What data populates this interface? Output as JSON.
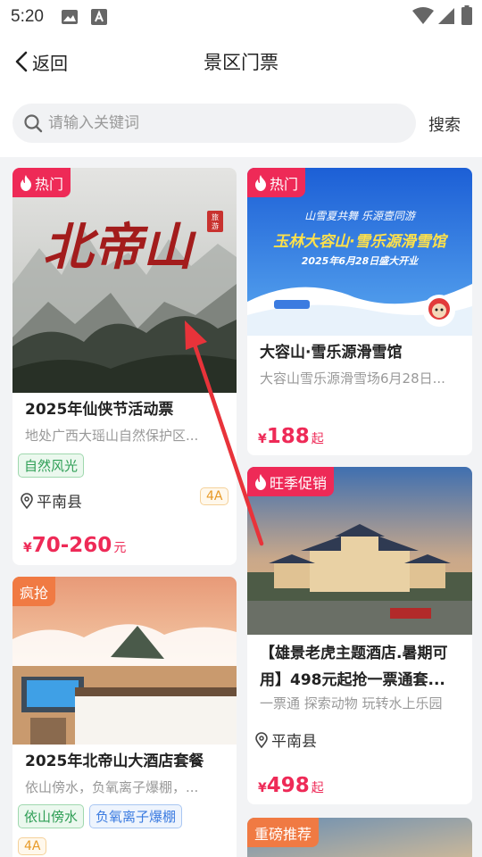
{
  "status_bar": {
    "time": "5:20"
  },
  "nav": {
    "back_label": "返回",
    "title": "景区门票"
  },
  "search": {
    "placeholder": "请输入关键词",
    "value": "",
    "button_label": "搜索"
  },
  "colors": {
    "accent": "#ee2a57",
    "badge_orange": "#f07a43",
    "tag_green": "#2e9e55",
    "tag_blue": "#3b7be0",
    "level_orange": "#e79a27"
  },
  "cards": [
    {
      "badge": "热门",
      "image_logo_text": "北帝山",
      "image_seal_text": "旅游",
      "title": "2025年仙侠节活动票",
      "subtitle": "地处广西大瑶山自然保护区...",
      "tags": [
        "自然风光"
      ],
      "level": "4A",
      "location": "平南县",
      "price_currency": "¥",
      "price": "70-260",
      "price_unit": "元"
    },
    {
      "badge": "热门",
      "image_banner_line1": "山雪夏共舞  乐源壹同游",
      "image_banner_line2": "玉林大容山·雪乐源滑雪馆",
      "image_banner_line3": "2025年6月28日盛大开业",
      "title": "大容山·雪乐源滑雪馆",
      "subtitle": "大容山雪乐源滑雪场6月28日...",
      "price_currency": "¥",
      "price": "188",
      "price_unit": "起"
    },
    {
      "badge": "旺季促销",
      "title": "【雄景老虎主题酒店.暑期可用】498元起抢一票通套...",
      "subtitle": "一票通 探索动物 玩转水上乐园",
      "location": "平南县",
      "price_currency": "¥",
      "price": "498",
      "price_unit": "起"
    },
    {
      "badge": "疯抢",
      "title": "2025年北帝山大酒店套餐",
      "subtitle": "依山傍水，负氧离子爆棚，...",
      "tags": [
        "依山傍水",
        "负氧离子爆棚"
      ],
      "level": "4A"
    },
    {
      "badge": "重磅推荐"
    }
  ]
}
